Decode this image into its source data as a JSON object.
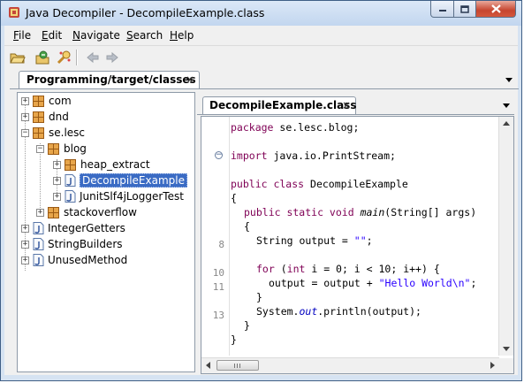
{
  "window": {
    "title": "Java Decompiler - DecompileExample.class"
  },
  "menu": [
    {
      "accel": "F",
      "rest": "ile"
    },
    {
      "accel": "E",
      "rest": "dit"
    },
    {
      "accel": "N",
      "rest": "avigate"
    },
    {
      "accel": "S",
      "rest": "earch"
    },
    {
      "accel": "H",
      "rest": "elp"
    }
  ],
  "toolbar": {
    "icons": [
      "open-file-icon",
      "open-type-icon",
      "search-type-icon",
      "back-arrow-icon",
      "forward-arrow-icon"
    ]
  },
  "left_tab": {
    "label": "Programming/target/classes",
    "close": "×"
  },
  "tree": {
    "com": "com",
    "dnd": "dnd",
    "se_lesc": "se.lesc",
    "blog": "blog",
    "heap_extract": "heap_extract",
    "decompile_example": "DecompileExample",
    "junit_logger": "JunitSlf4jLoggerTest",
    "stackoverflow": "stackoverflow",
    "integer_getters": "IntegerGetters",
    "string_builders": "StringBuilders",
    "unused_method": "UnusedMethod",
    "expanded": "−",
    "collapsed": "+"
  },
  "editor_tab": {
    "label": "DecompileExample.class",
    "close": "×"
  },
  "code": {
    "l1_kw": "package",
    "l1_rest": " se.lesc.blog;",
    "l2_kw": "import",
    "l2_rest": " java.io.PrintStream;",
    "l3_kw": "public class",
    "l3_rest": " DecompileExample",
    "l4": "{",
    "l5_kw": "public static void",
    "l5_sp": " ",
    "l5_name": "main",
    "l5_rest": "(String[] args)",
    "l6": "{",
    "l7_a": "String output = ",
    "l7_str": "\"\"",
    "l7_b": ";",
    "l8_kw": "for",
    "l8_a": " (",
    "l8_kw2": "int",
    "l8_b": " i = 0; i < 10; i++) {",
    "l9_a": "output = output + ",
    "l9_str": "\"Hello World\\n\"",
    "l9_b": ";",
    "l10": "}",
    "l11_a": "System.",
    "l11_fld": "out",
    "l11_b": ".println(output);",
    "l12": "}",
    "l13": "}",
    "fold_sign": "−"
  },
  "line_numbers": {
    "n8": "8",
    "n10": "10",
    "n11": "11",
    "n13": "13"
  }
}
